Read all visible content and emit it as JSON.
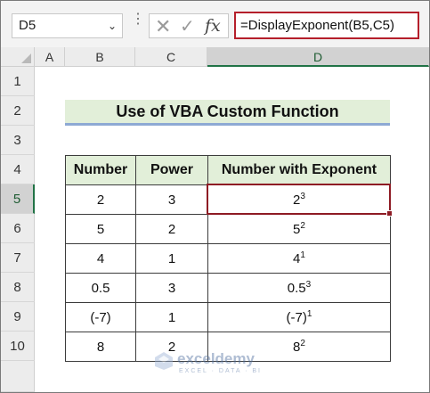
{
  "formula_bar": {
    "name_box": "D5",
    "formula": "=DisplayExponent(B5,C5)",
    "fx_label": "fx"
  },
  "columns": [
    "A",
    "B",
    "C",
    "D"
  ],
  "rows": [
    "1",
    "2",
    "3",
    "4",
    "5",
    "6",
    "7",
    "8",
    "9",
    "10"
  ],
  "active_cell": "D5",
  "sheet": {
    "title": "Use of VBA Custom Function",
    "headers": [
      "Number",
      "Power",
      "Number with Exponent"
    ],
    "data": [
      {
        "number": "2",
        "power": "3",
        "base": "2",
        "exp": "3"
      },
      {
        "number": "5",
        "power": "2",
        "base": "5",
        "exp": "2"
      },
      {
        "number": "4",
        "power": "1",
        "base": "4",
        "exp": "1"
      },
      {
        "number": "0.5",
        "power": "3",
        "base": "0.5",
        "exp": "3"
      },
      {
        "number": "(-7)",
        "power": "1",
        "base": "(-7)",
        "exp": "1"
      },
      {
        "number": "8",
        "power": "2",
        "base": "8",
        "exp": "2"
      }
    ]
  },
  "watermark": {
    "brand": "exceldemy",
    "tagline": "EXCEL · DATA · BI"
  },
  "colors": {
    "accent_green": "#217346",
    "formula_border": "#b51f2b",
    "title_fill": "#e2efd9",
    "title_underline": "#8ea9d4"
  }
}
